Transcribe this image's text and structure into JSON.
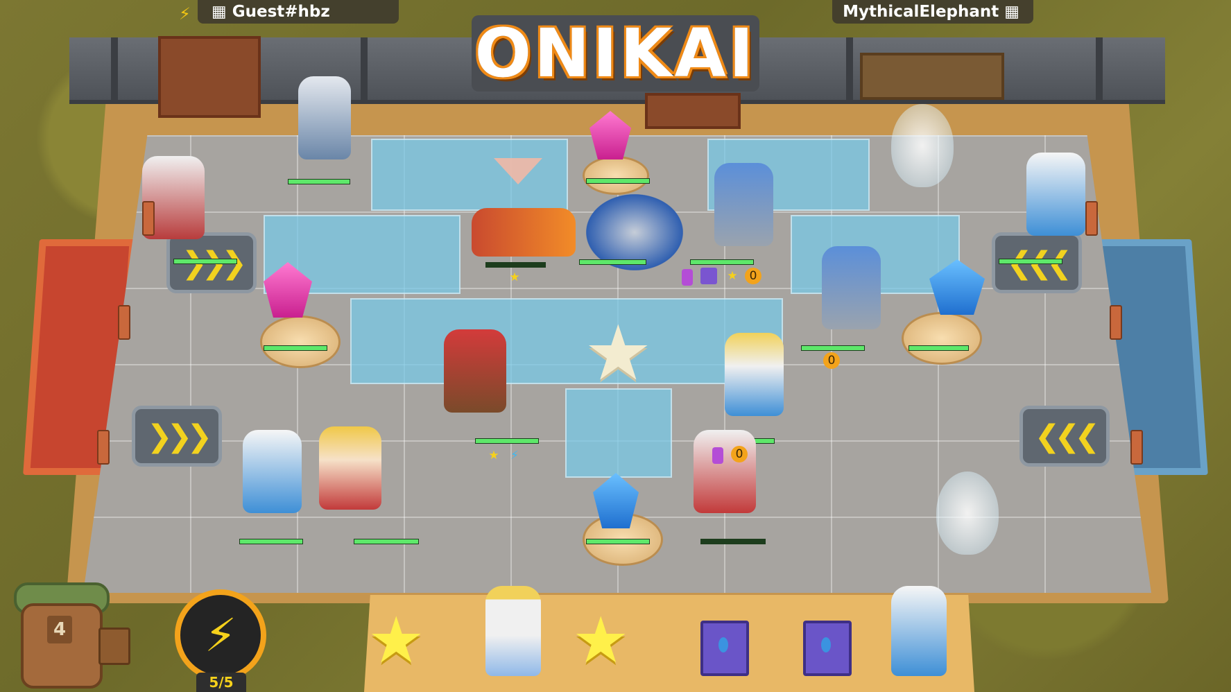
{
  "game": {
    "logo": "ONIKAI"
  },
  "players": {
    "left": {
      "name": "Guest#hbz",
      "icon": "castle-icon",
      "status_icon": "lightning-icon"
    },
    "right": {
      "name": "MythicalElephant",
      "icon": "castle-icon"
    }
  },
  "hud": {
    "energy": {
      "current": 5,
      "max": 5,
      "label": "5/5",
      "icon": "lightning-icon"
    },
    "backpack": {
      "level": "4",
      "icon": "backpack-icon"
    }
  },
  "bench": {
    "slots": [
      {
        "type": "star",
        "icon": "star-icon"
      },
      {
        "type": "unit",
        "icon": "king-unit-icon"
      },
      {
        "type": "star",
        "icon": "star-icon"
      },
      {
        "type": "book",
        "icon": "spellbook-icon"
      },
      {
        "type": "book",
        "icon": "spellbook-icon"
      },
      {
        "type": "unit",
        "icon": "ice-mage-unit-icon"
      }
    ]
  },
  "colors": {
    "accent_orange": "#f08a16",
    "energy_yellow": "#f6d11b",
    "hp_green": "#5ee86a",
    "board_blue": "#78c8e6",
    "crystal_pink": "#ff7ad1",
    "crystal_blue": "#1f6fcf"
  }
}
